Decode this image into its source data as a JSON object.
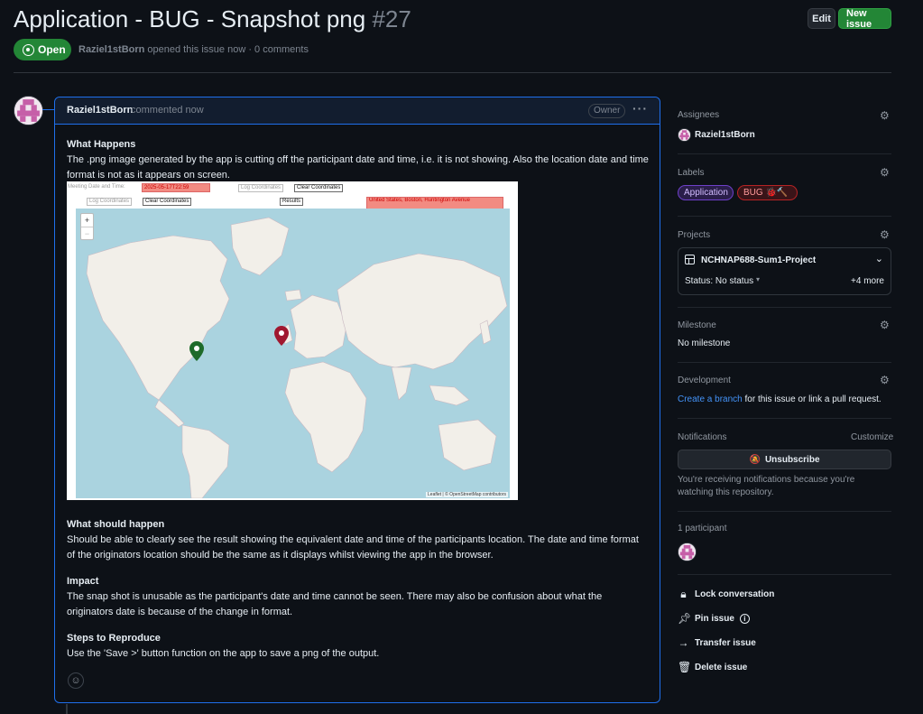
{
  "issue": {
    "title": "Application - BUG - Snapshot png",
    "number": "#27",
    "state": "Open",
    "author": "Raziel1stBorn",
    "meta_rest": "opened this issue now · 0 comments"
  },
  "header": {
    "edit_label": "Edit",
    "new_issue_label": "New issue"
  },
  "comment": {
    "author": "Raziel1stBorn",
    "when": "commented now",
    "badge": "Owner",
    "menu_icon": "kebab-horizontal-icon",
    "sections": [
      {
        "heading": "What Happens",
        "text": "The .png image generated by the app is cutting off the participant date and time, i.e. it is not showing. Also the location date and time format is not as it appears on screen."
      },
      {
        "heading": "What should happen",
        "text": "Should be able to clearly see the result showing the equivalent date and time of the participants location. The date and time format of the originators location should be the same as it displays whilst viewing the app in the browser."
      },
      {
        "heading": "Impact",
        "text": "The snap shot is unusable as the participant's date and time cannot be seen. There may also be confusion about what the originators date is because of the change in format."
      },
      {
        "heading": "Steps to Reproduce",
        "text": "Use the 'Save >' button function on the app to save a png of the output."
      }
    ]
  },
  "snapshot": {
    "meeting_label": "Meeting Date and Time:",
    "meeting_value": "2025-05-17T22:59",
    "log_coords_1": "Log Coordinates",
    "clear_coords_1": "Clear Coordinates",
    "log_coords_2": "Log Coordinates",
    "clear_coords_2": "Clear Coordinates",
    "results": "Results",
    "location_value": "United States, Boston, Huntington Avenue",
    "zoom_in": "+",
    "zoom_out": "−",
    "attribution": "Leaflet | © OpenStreetMap contributors",
    "markers": [
      {
        "name": "boston-marker",
        "color": "#1e6b2a"
      },
      {
        "name": "uk-marker",
        "color": "#a0172f"
      }
    ]
  },
  "sidebar": {
    "assignees": {
      "label": "Assignees",
      "value": "Raziel1stBorn"
    },
    "labels": {
      "label": "Labels",
      "items": [
        {
          "text": "Application",
          "color": "#6e40c9"
        },
        {
          "text": "BUG",
          "color": "#b62324"
        }
      ]
    },
    "projects": {
      "label": "Projects",
      "name": "NCHNAP688-Sum1-Project",
      "status": "Status: No status",
      "more": "+4 more"
    },
    "milestone": {
      "label": "Milestone",
      "value": "No milestone"
    },
    "development": {
      "label": "Development",
      "link": "Create a branch",
      "rest": "for this issue or link a pull request."
    },
    "notifications": {
      "label": "Notifications",
      "customize": "Customize",
      "button": "Unsubscribe",
      "note": "You're receiving notifications because you're watching this repository."
    },
    "participants": {
      "label": "1 participant"
    },
    "actions": {
      "lock": "Lock conversation",
      "pin": "Pin issue",
      "transfer": "Transfer issue",
      "delete": "Delete issue"
    }
  },
  "colors": {
    "accent_green": "#238636",
    "link_blue": "#4493f8",
    "comment_border": "#1f6feb"
  }
}
